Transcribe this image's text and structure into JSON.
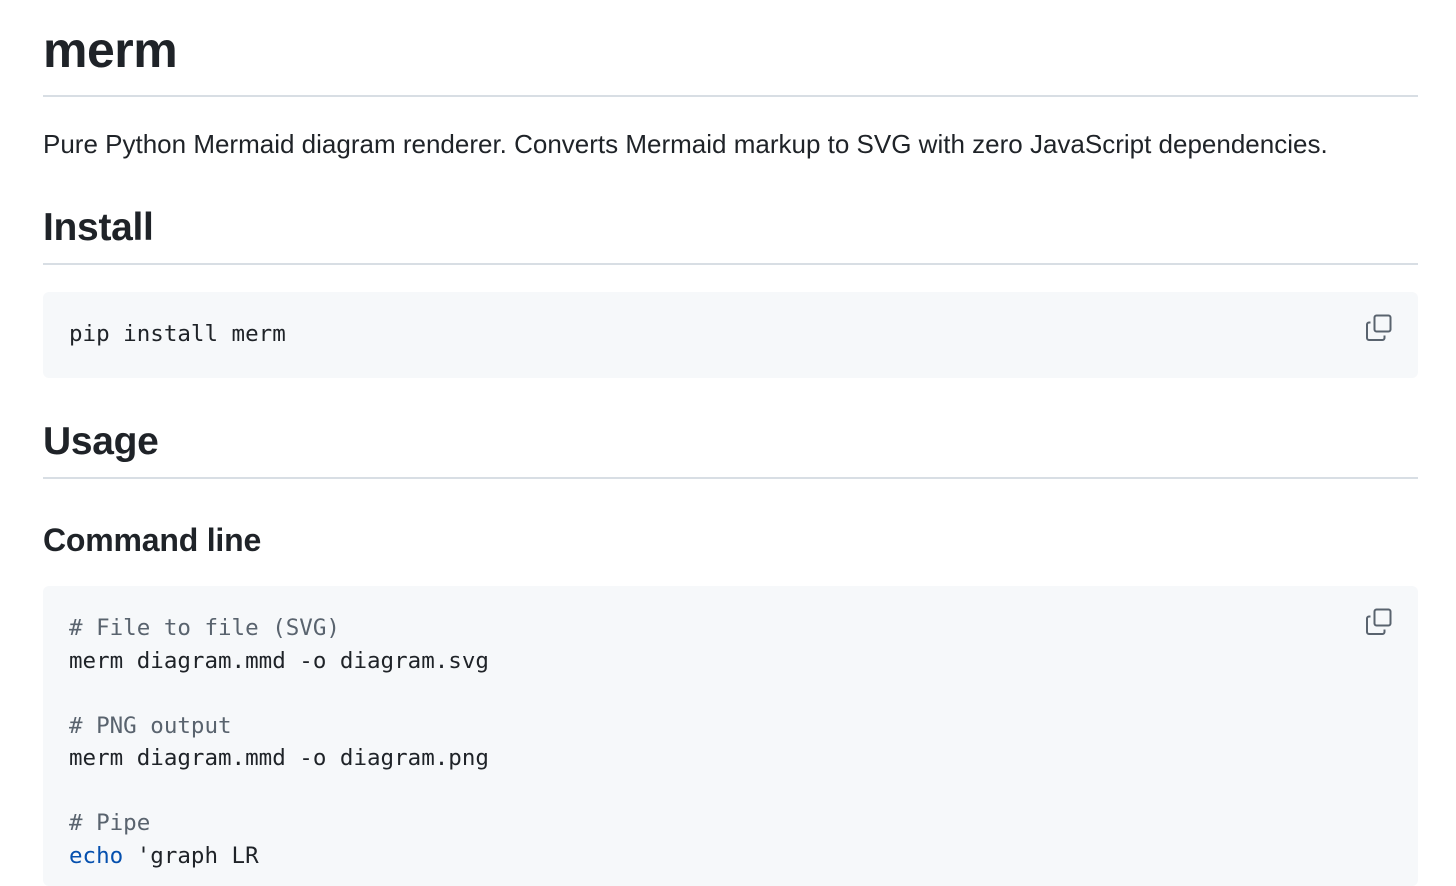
{
  "readme": {
    "title": "merm",
    "description": "Pure Python Mermaid diagram renderer. Converts Mermaid markup to SVG with zero JavaScript dependencies.",
    "install": {
      "heading": "Install",
      "code": "pip install merm",
      "copy_icon": "copy-icon"
    },
    "usage": {
      "heading": "Usage",
      "command_line": {
        "heading": "Command line",
        "copy_icon": "copy-icon",
        "lines": [
          {
            "text": "# File to file (SVG)",
            "kind": "comment"
          },
          {
            "text": "merm diagram.mmd -o diagram.svg",
            "kind": "code"
          },
          {
            "text": "",
            "kind": "blank"
          },
          {
            "text": "# PNG output",
            "kind": "comment"
          },
          {
            "text": "merm diagram.mmd -o diagram.png",
            "kind": "code"
          },
          {
            "text": "",
            "kind": "blank"
          },
          {
            "text": "# Pipe",
            "kind": "comment"
          }
        ],
        "last_line": {
          "keyword": "echo",
          "rest": " 'graph LR"
        }
      }
    }
  },
  "colors": {
    "text": "#1f2328",
    "comment": "#59636e",
    "keyword": "#0550ae",
    "code_background": "#f6f8fa",
    "rule": "#d8dee4"
  }
}
